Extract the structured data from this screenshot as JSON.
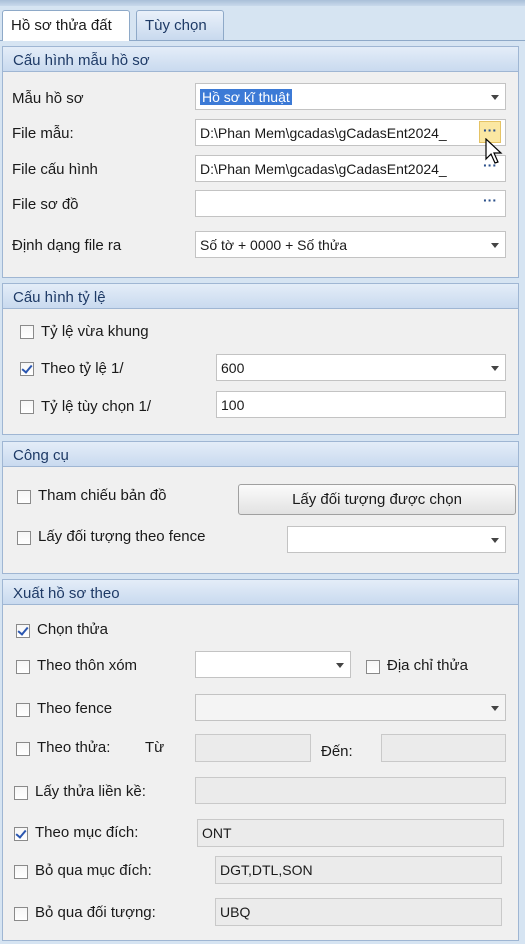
{
  "tabs": [
    {
      "label": "Hồ sơ thửa đất",
      "active": true
    },
    {
      "label": "Tùy chọn",
      "active": false
    }
  ],
  "template_config": {
    "title": "Cấu hình mẫu hồ sơ",
    "template_label": "Mẫu hồ sơ",
    "template_value": "Hồ sơ kĩ thuật",
    "template_file_label": "File mẫu:",
    "template_file_value": "D:\\Phan Mem\\gcadas\\gCadasEnt2024_",
    "config_file_label": "File cấu hình",
    "config_file_value": "D:\\Phan Mem\\gcadas\\gCadasEnt2024_",
    "diagram_file_label": "File sơ đồ",
    "diagram_file_value": "",
    "output_format_label": "Định dạng file ra",
    "output_format_value": "Số tờ +  0000 +  Số thửa",
    "ellipsis": "···"
  },
  "scale_config": {
    "title": "Cấu hình tỷ lệ",
    "fit_frame_label": "Tỷ lệ vừa khung",
    "fit_frame_checked": false,
    "by_scale_label": "Theo tỷ lệ 1/",
    "by_scale_checked": true,
    "by_scale_value": "600",
    "custom_scale_label": "Tỷ lệ tùy chọn 1/",
    "custom_scale_checked": false,
    "custom_scale_value": "100"
  },
  "tools": {
    "title": "Công cụ",
    "reference_map_label": "Tham chiếu bản đồ",
    "reference_map_checked": false,
    "get_selected_button": "Lấy đối tượng được chọn",
    "get_by_fence_label": "Lấy đối tượng theo fence",
    "get_by_fence_checked": false,
    "fence_value": ""
  },
  "export": {
    "title": "Xuất hồ sơ theo",
    "select_parcel_label": "Chọn thửa",
    "select_parcel_checked": true,
    "by_hamlet_label": "Theo thôn xóm",
    "by_hamlet_checked": false,
    "hamlet_value": "",
    "parcel_address_label": "Địa chỉ thửa",
    "parcel_address_checked": false,
    "by_fence_label": "Theo fence",
    "by_fence_checked": false,
    "fence_value": "",
    "by_parcel_label": "Theo thửa:",
    "by_parcel_checked": false,
    "from_label": "Từ",
    "from_value": "",
    "to_label": "Đến:",
    "to_value": "",
    "adjacent_label": "Lấy thửa liền kề:",
    "adjacent_checked": false,
    "adjacent_value": "",
    "purpose_label": "Theo mục đích:",
    "purpose_checked": true,
    "purpose_value": "ONT",
    "skip_purpose_label": "Bỏ qua mục đích:",
    "skip_purpose_checked": false,
    "skip_purpose_value": "DGT,DTL,SON",
    "skip_object_label": "Bỏ qua đối tượng:",
    "skip_object_checked": false,
    "skip_object_value": "UBQ"
  }
}
